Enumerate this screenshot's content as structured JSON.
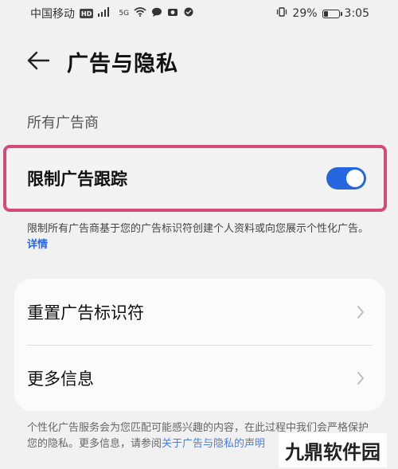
{
  "status_bar": {
    "carrier": "中国移动",
    "hd_badge": "HD",
    "signal_label": "5G",
    "battery_percent": "29%",
    "battery_level": 0.29,
    "time": "3:05"
  },
  "header": {
    "title": "广告与隐私"
  },
  "section": {
    "label": "所有广告商"
  },
  "toggle": {
    "label": "限制广告跟踪",
    "enabled": true,
    "color_on": "#2667e0"
  },
  "description": {
    "text": "限制所有广告商基于您的广告标识符创建个人资料或向您展示个性化广告。",
    "link": "详情"
  },
  "card": {
    "items": [
      {
        "label": "重置广告标识符"
      },
      {
        "label": "更多信息"
      }
    ]
  },
  "footer": {
    "text": "个性化广告服务会为您匹配可能感兴趣的内容，在此过程中我们会严格保护您的隐私。更多信息，请参阅",
    "link": "关于广告与隐私的声明"
  },
  "watermark": {
    "text": "九鼎软件园"
  },
  "colors": {
    "accent": "#2667e0",
    "highlight_border": "#d44a7a"
  }
}
